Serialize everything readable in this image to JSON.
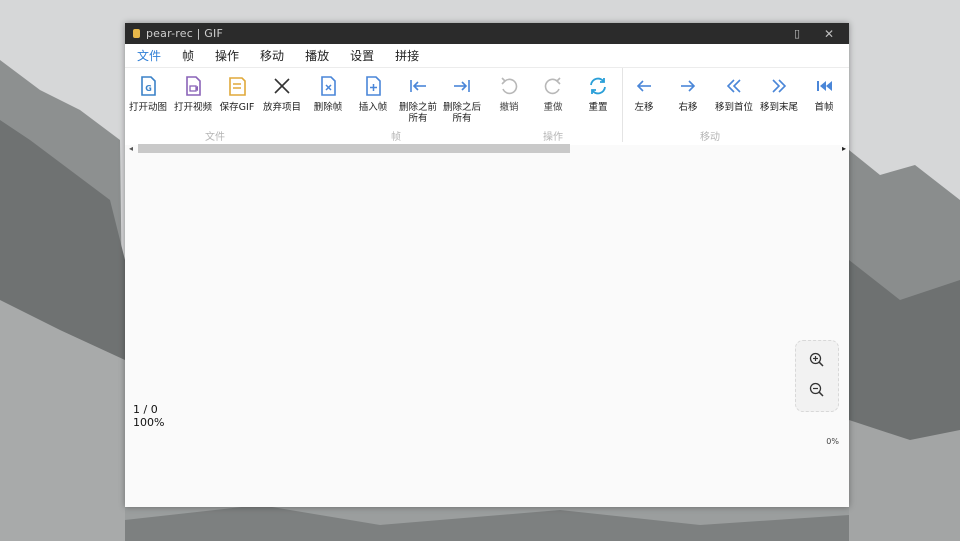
{
  "window": {
    "title": "pear-rec | GIF"
  },
  "menu": [
    "文件",
    "帧",
    "操作",
    "移动",
    "播放",
    "设置",
    "拼接"
  ],
  "toolbar": {
    "file": {
      "group_label": "文件",
      "open_gif": "打开动图",
      "open_video": "打开视频",
      "save_gif": "保存GIF",
      "discard": "放弃项目"
    },
    "frame": {
      "group_label": "帧",
      "delete_frame": "删除帧",
      "insert_frame": "插入帧",
      "delete_before": "删除之前所有",
      "delete_after": "删除之后所有"
    },
    "operation": {
      "group_label": "操作",
      "undo": "撤销",
      "redo": "重做",
      "reset": "重置"
    },
    "move": {
      "group_label": "移动",
      "move_left": "左移",
      "move_right": "右移",
      "move_first": "移到首位",
      "move_last": "移到末尾",
      "first_frame": "首帧"
    }
  },
  "status": {
    "frame_counter": "1 / 0",
    "zoom_level": "100%",
    "progress": "0%"
  },
  "colors": {
    "accent": "#2f7fd6",
    "gif_icon": "#3b82c8",
    "video_icon": "#8a63b8",
    "save_icon": "#e0a93a",
    "frame_icon": "#4a86d8",
    "reset_icon": "#2a9fd8"
  }
}
